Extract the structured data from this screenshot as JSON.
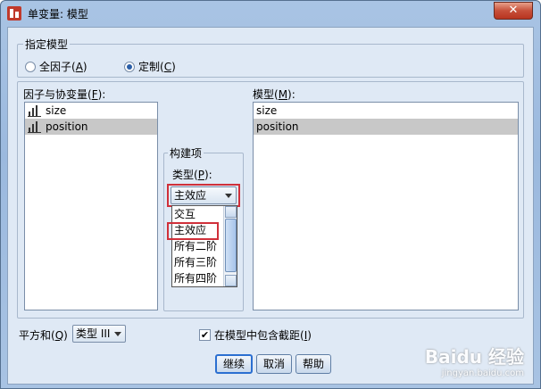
{
  "window": {
    "title": "单变量: 模型",
    "close_glyph": "✕"
  },
  "specify_model": {
    "legend": "指定模型",
    "options": [
      {
        "label": "全因子(",
        "key": "A",
        "suffix": ")",
        "selected": false
      },
      {
        "label": "定制(",
        "key": "C",
        "suffix": ")",
        "selected": true
      }
    ]
  },
  "factors": {
    "label": "因子与协变量(",
    "key": "F",
    "suffix": "):",
    "items": [
      {
        "label": "size",
        "icon": "scale-variable-icon",
        "selected": false
      },
      {
        "label": "position",
        "icon": "scale-variable-icon",
        "selected": true
      }
    ]
  },
  "build_term": {
    "legend": "构建项",
    "type_label": "类型(",
    "type_key": "P",
    "type_suffix": "):",
    "selected_value": "主效应",
    "dropdown_options": [
      "交互",
      "主效应",
      "所有二阶",
      "所有三阶",
      "所有四阶"
    ],
    "dropdown_highlighted": "主效应"
  },
  "model": {
    "label": "模型(",
    "key": "M",
    "suffix": "):",
    "items": [
      {
        "label": "size",
        "selected": false
      },
      {
        "label": "position",
        "selected": true
      }
    ]
  },
  "sum_of_squares": {
    "label": "平方和(",
    "key": "Q",
    "suffix": ")",
    "value": "类型 III"
  },
  "include_intercept": {
    "label": "在模型中包含截距(",
    "key": "I",
    "suffix": ")",
    "checked": true,
    "check_glyph": "✔"
  },
  "buttons": {
    "continue": "继续",
    "cancel": "取消",
    "help": "帮助"
  },
  "watermark": {
    "text": "Baidu 经验",
    "sub": "jingyan.baidu.com"
  },
  "colors": {
    "highlight": "#d0303a",
    "selection": "#c8c8c8",
    "accent": "#2b6fd1"
  }
}
